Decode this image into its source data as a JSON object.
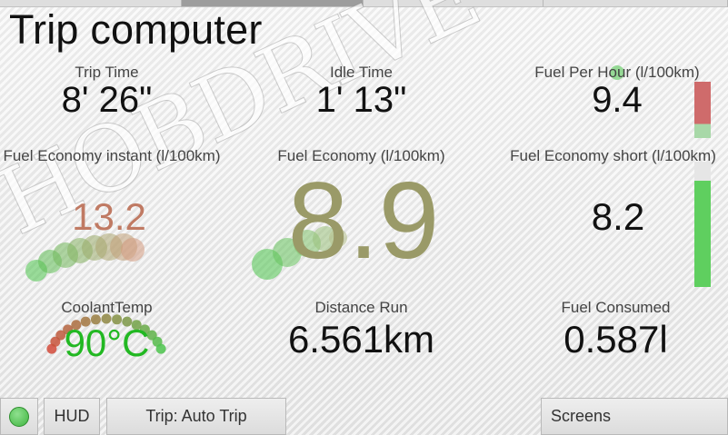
{
  "screen": {
    "title": "Trip computer",
    "watermark": "HOBDRIVE"
  },
  "top_tabs": [
    {
      "active": false
    },
    {
      "active": true
    },
    {
      "active": false
    },
    {
      "active": false
    }
  ],
  "gauges": {
    "trip_time": {
      "label": "Trip Time",
      "value": "8' 26\""
    },
    "idle_time": {
      "label": "Idle Time",
      "value": "1' 13\""
    },
    "fuel_per_hour": {
      "label": "Fuel Per Hour (l/100km)",
      "value": "9.4",
      "bar_level": 0.25,
      "bar_color": "#cf6b6b",
      "bar_track_color": "#a8d8a8"
    },
    "fuel_economy_instant": {
      "label": "Fuel Economy instant (l/100km)",
      "value": "13.2",
      "value_color": "#c07a63"
    },
    "fuel_economy": {
      "label": "Fuel Economy (l/100km)",
      "value": "8.9",
      "value_color": "#9a9a68"
    },
    "fuel_economy_short": {
      "label": "Fuel Economy short (l/100km)",
      "value": "8.2",
      "bar_level": 0.85,
      "bar_color": "#5fcf5f",
      "bar_track_color": "#e6e6e6"
    },
    "coolant_temp": {
      "label": "CoolantTemp",
      "value": "90°C",
      "value_color": "#22b822"
    },
    "distance_run": {
      "label": "Distance Run",
      "value": "6.561km"
    },
    "fuel_consumed": {
      "label": "Fuel Consumed",
      "value": "0.587l"
    }
  },
  "toolbar": {
    "status": {
      "color": "#3fb53f"
    },
    "hud_label": "HUD",
    "trip_label": "Trip: Auto Trip",
    "screens_label": "Screens"
  },
  "colors": {
    "good": "#4cc44c",
    "warn": "#c9a070",
    "bad": "#d24a3a"
  }
}
